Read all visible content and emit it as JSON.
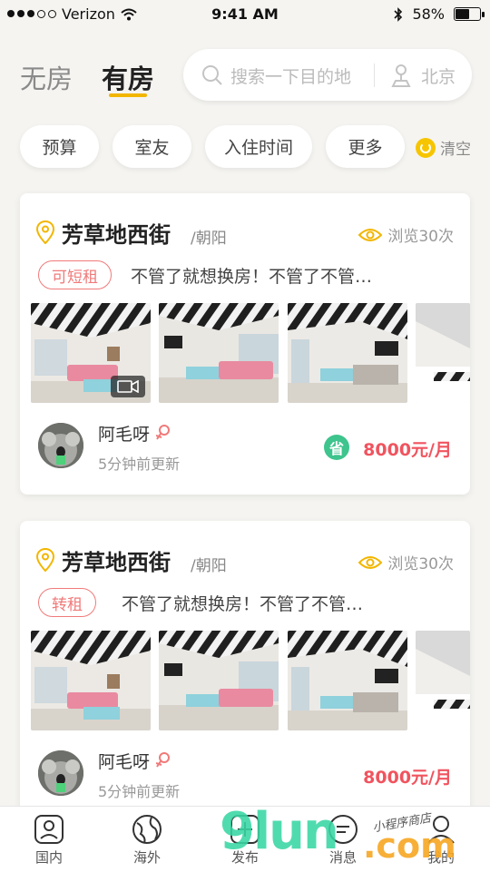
{
  "status_bar": {
    "carrier": "Verizon",
    "time": "9:41 AM",
    "battery": "58%",
    "battery_level": 0.58
  },
  "header": {
    "tabs": [
      {
        "label": "无房",
        "active": false
      },
      {
        "label": "有房",
        "active": true
      }
    ],
    "search": {
      "placeholder": "搜索一下目的地",
      "city": "北京"
    }
  },
  "filters": {
    "chips": [
      "预算",
      "室友",
      "入住时间",
      "更多"
    ],
    "clear_label": "清空"
  },
  "listings": [
    {
      "street": "芳草地西街",
      "district": "/朝阳",
      "views": "浏览30次",
      "tag": "可短租",
      "description": "不管了就想换房！不管了不管…",
      "user": {
        "name": "阿毛呀",
        "updated": "5分钟前更新"
      },
      "save_badge": "省",
      "price": "8000元/月"
    },
    {
      "street": "芳草地西街",
      "district": "/朝阳",
      "views": "浏览30次",
      "tag": "转租",
      "description": "不管了就想换房！不管了不管…",
      "user": {
        "name": "阿毛呀",
        "updated": "5分钟前更新"
      },
      "price": "8000元/月"
    }
  ],
  "bottom_nav": [
    {
      "label": "国内",
      "icon": "home-icon"
    },
    {
      "label": "海外",
      "icon": "globe-icon"
    },
    {
      "label": "发布",
      "icon": "add-icon"
    },
    {
      "label": "消息",
      "icon": "message-icon"
    },
    {
      "label": "我的",
      "icon": "profile-icon"
    }
  ],
  "watermark": {
    "brand": "9lun",
    "domain": ".com",
    "tagline": "小程序商店"
  },
  "colors": {
    "accent": "#f2b600",
    "price": "#f0545f",
    "tag": "#f07a7a",
    "save": "#3ec48d"
  }
}
